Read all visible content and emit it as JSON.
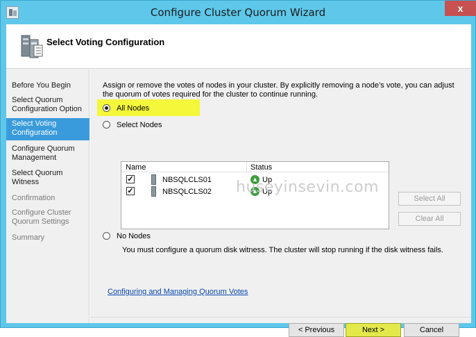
{
  "window": {
    "title": "Configure Cluster Quorum Wizard",
    "close_glyph": "x"
  },
  "header": {
    "title": "Select Voting Configuration"
  },
  "sidebar": {
    "items": [
      {
        "label": "Before You Begin",
        "state": "normal"
      },
      {
        "label": "Select Quorum Configuration Option",
        "state": "normal"
      },
      {
        "label": "Select Voting Configuration",
        "state": "active"
      },
      {
        "label": "Configure Quorum Management",
        "state": "normal"
      },
      {
        "label": "Select Quorum Witness",
        "state": "normal"
      },
      {
        "label": "Confirmation",
        "state": "disabled"
      },
      {
        "label": "Configure Cluster Quorum Settings",
        "state": "disabled"
      },
      {
        "label": "Summary",
        "state": "disabled"
      }
    ]
  },
  "main": {
    "description": "Assign or remove the votes of nodes in your cluster. By explicitly removing a node’s vote, you can adjust the quorum of votes required for the cluster to continue running.",
    "options": {
      "all_nodes": "All Nodes",
      "select_nodes": "Select Nodes",
      "no_nodes": "No Nodes"
    },
    "selected_option": "all_nodes",
    "grid": {
      "headers": {
        "name": "Name",
        "status": "Status"
      },
      "rows": [
        {
          "name": "NBSQLCLS01",
          "status": "Up",
          "checked": true
        },
        {
          "name": "NBSQLCLS02",
          "status": "Up",
          "checked": true
        }
      ]
    },
    "watermark": "huseyinsevin.com",
    "select_all_label": "Select All",
    "clear_all_label": "Clear All",
    "no_nodes_note": "You must configure a quorum disk witness. The cluster will stop running if the disk witness fails.",
    "link": "Configuring and Managing Quorum Votes"
  },
  "footer": {
    "previous_label": "< Previous",
    "next_label": "Next >",
    "cancel_label": "Cancel"
  },
  "colors": {
    "titlebar": "#5ec7ea",
    "active_nav": "#3a9bdc",
    "highlight": "#f4f73a"
  }
}
